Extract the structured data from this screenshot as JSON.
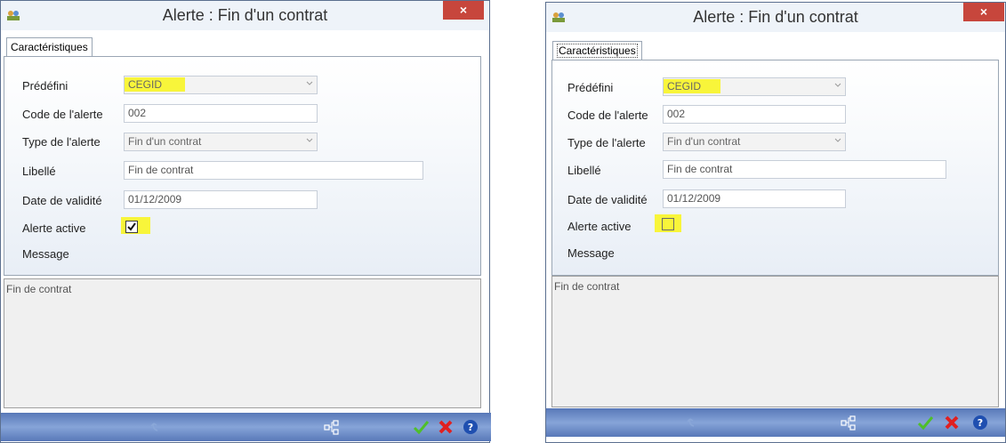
{
  "dialogs": [
    {
      "title": "Alerte : Fin d'un contrat",
      "close_label": "×",
      "tab_label": "Caractéristiques",
      "labels": {
        "predefini": "Prédéfini",
        "code": "Code de l'alerte",
        "type": "Type de l'alerte",
        "libelle": "Libellé",
        "date": "Date de validité",
        "active": "Alerte active",
        "message": "Message"
      },
      "values": {
        "predefini": "CEGID",
        "code": "002",
        "type": "Fin d'un contrat",
        "libelle": "Fin de contrat",
        "date": "01/12/2009",
        "active": true,
        "message": "Fin de contrat"
      }
    },
    {
      "title": "Alerte : Fin d'un contrat",
      "close_label": "×",
      "tab_label": "Caractéristiques",
      "labels": {
        "predefini": "Prédéfini",
        "code": "Code de l'alerte",
        "type": "Type de l'alerte",
        "libelle": "Libellé",
        "date": "Date de validité",
        "active": "Alerte active",
        "message": "Message"
      },
      "values": {
        "predefini": "CEGID",
        "code": "002",
        "type": "Fin d'un contrat",
        "libelle": "Fin de contrat",
        "date": "01/12/2009",
        "active": false,
        "message": "Fin de contrat"
      }
    }
  ],
  "colors": {
    "highlight": "#f8f53a",
    "toolbar": "#6f8fcb",
    "close": "#c7463c"
  },
  "icons": [
    "app-icon",
    "undo-icon",
    "tree-icon",
    "validate-icon",
    "cancel-icon",
    "help-icon"
  ]
}
